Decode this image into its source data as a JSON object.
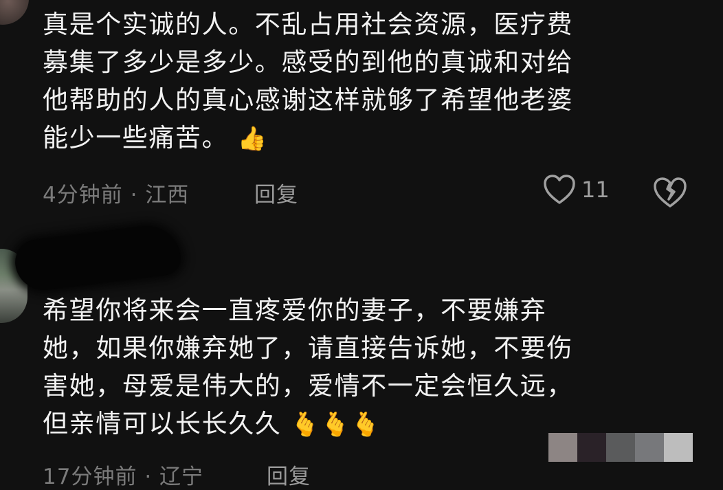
{
  "comments": [
    {
      "text_lines": [
        "真是个实诚的人。不乱占用社会资源，医疗费",
        "募集了多少是多少。感受的到他的真诚和对给",
        "他帮助的人的真心感谢这样就够了希望他老婆",
        "能少一些痛苦。"
      ],
      "emoji": "👍",
      "time": "4分钟前",
      "separator": "·",
      "location": "江西",
      "reply_label": "回复",
      "likes": "11"
    },
    {
      "text_lines": [
        "希望你将来会一直疼爱你的妻子，不要嫌弃",
        "她，如果你嫌弃她了，请直接告诉她，不要伤",
        "害她，母爱是伟大的，爱情不一定会恒久远，",
        "但亲情可以长长久久"
      ],
      "emoji": "🫰🫰🫰",
      "time": "17分钟前",
      "separator": "·",
      "location": "辽宁",
      "reply_label": "回复"
    }
  ],
  "icons": {
    "like": "heart-outline-icon",
    "dislike": "broken-heart-icon"
  },
  "colors": {
    "background": "#111111",
    "text": "#f2f2f2",
    "meta": "#7b7b7b",
    "emoji_heart": "#ff2d6d",
    "emoji_hand": "#f7c300"
  },
  "pixel_strip": [
    "#8d8584",
    "#2a2228",
    "#5a5b5c",
    "#77787b",
    "#bdbdbd"
  ]
}
